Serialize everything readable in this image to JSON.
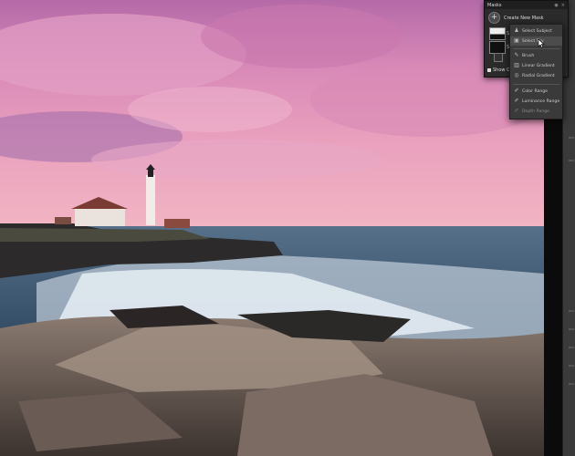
{
  "masks_panel": {
    "title": "Masks",
    "header_icons": [
      "eye-icon",
      "close-icon"
    ],
    "create_label": "Create New Mask",
    "masks": [
      {
        "name": "Sk",
        "thumb": "white-top"
      },
      {
        "name": "Sk",
        "thumb": "dark"
      }
    ],
    "show_overlay_label": "Show Ov"
  },
  "dropdown": {
    "items": [
      {
        "label": "Select Subject",
        "icon": "person-icon",
        "highlighted": false,
        "disabled": false
      },
      {
        "label": "Select Sky",
        "icon": "sky-icon",
        "highlighted": true,
        "disabled": false
      },
      {
        "label": "Brush",
        "icon": "brush-icon",
        "highlighted": false,
        "disabled": false
      },
      {
        "label": "Linear Gradient",
        "icon": "linear-gradient-icon",
        "highlighted": false,
        "disabled": false
      },
      {
        "label": "Radial Gradient",
        "icon": "radial-gradient-icon",
        "highlighted": false,
        "disabled": false
      },
      {
        "label": "Color Range",
        "icon": "color-range-icon",
        "highlighted": false,
        "disabled": false
      },
      {
        "label": "Luminance Range",
        "icon": "luminance-range-icon",
        "highlighted": false,
        "disabled": false
      },
      {
        "label": "Depth Range",
        "icon": "depth-range-icon",
        "highlighted": false,
        "disabled": true
      }
    ]
  },
  "colors": {
    "panel_bg": "#2b2b2b",
    "menu_bg": "#3a3a3a",
    "highlight": "#4c4c4c"
  }
}
